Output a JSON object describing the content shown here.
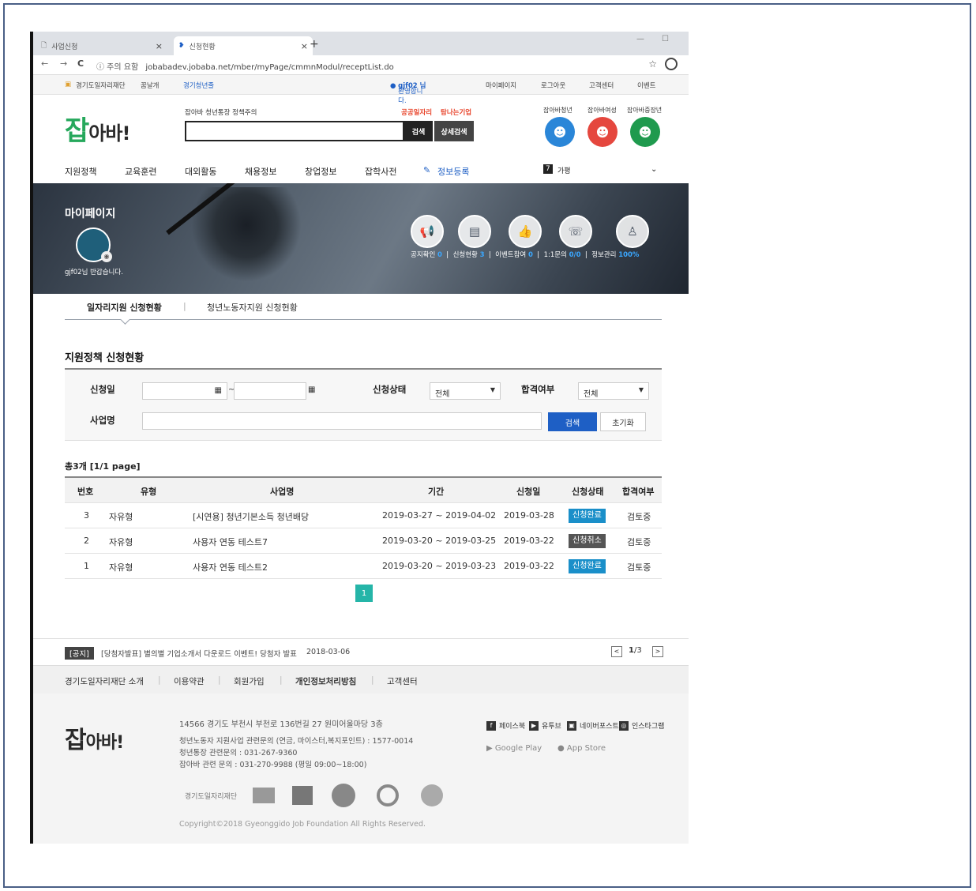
{
  "browser": {
    "tabs": [
      {
        "title": "사업신청"
      },
      {
        "title": "신청현황"
      }
    ],
    "url_warning": "ⓘ 주의 요함",
    "url": "jobabadev.jobaba.net/mber/myPage/cmmnModul/receptList.do"
  },
  "util": {
    "foundation": "경기도일자리재단",
    "dream": "꿈날개",
    "youth": "경기청년줄",
    "welcome_prefix": "환영합니다.",
    "user": "gjf02 님",
    "mypage": "마이페이지",
    "logout": "로그아웃",
    "support": "고객센터",
    "event": "이벤트"
  },
  "header": {
    "logo_main": "잡",
    "logo_sub": "아바!",
    "links": "잡아바   청년통장   정책주의",
    "search_btn": "검색",
    "detail_search_btn": "상세검색",
    "pub_jobs": "공공일자리",
    "good_company": "탐나는기업",
    "avatars": [
      "잡아바청년",
      "잡아바여성",
      "잡아바중장년"
    ]
  },
  "gnb": {
    "items": [
      "지원정책",
      "교육훈련",
      "대외활동",
      "채용정보",
      "창업정보",
      "잡학사전",
      "정보등록"
    ],
    "weather_num": "7",
    "weather_txt": "가평"
  },
  "hero": {
    "title": "마이페이지",
    "greeting": "gjf02님 반갑습니다.",
    "stats": [
      {
        "label": "공지확인",
        "value": "0"
      },
      {
        "label": "신청현황",
        "value": "3"
      },
      {
        "label": "이벤트참여",
        "value": "0"
      },
      {
        "label": "1:1문의",
        "value": "0/0"
      },
      {
        "label": "정보관리",
        "value": "100%"
      }
    ]
  },
  "subtabs": {
    "active": "일자리지원 신청현황",
    "other": "청년노동자지원 신청현황"
  },
  "section_title": "지원정책 신청현황",
  "filter": {
    "date_label": "신청일",
    "tilde": "~",
    "status_label": "신청상태",
    "status_value": "전체",
    "pass_label": "합격여부",
    "pass_value": "전체",
    "name_label": "사업명",
    "search_btn": "검색",
    "reset_btn": "초기화"
  },
  "total": "총3개 [1/1 page]",
  "table": {
    "headers": [
      "번호",
      "유형",
      "사업명",
      "기간",
      "신청일",
      "신청상태",
      "합격여부"
    ],
    "rows": [
      {
        "no": "3",
        "type": "자유형",
        "name": "[시연용] 청년기본소득 청년배당",
        "period": "2019-03-27 ~ 2019-04-02",
        "date": "2019-03-28",
        "status": "신청완료",
        "result": "검토중"
      },
      {
        "no": "2",
        "type": "자유형",
        "name": "사용자 연동 테스트7",
        "period": "2019-03-20 ~ 2019-03-25",
        "date": "2019-03-22",
        "status": "신청취소",
        "result": "검토중"
      },
      {
        "no": "1",
        "type": "자유형",
        "name": "사용자 연동 테스트2",
        "period": "2019-03-20 ~ 2019-03-23",
        "date": "2019-03-22",
        "status": "신청완료",
        "result": "검토중"
      }
    ]
  },
  "pager": {
    "current": "1"
  },
  "notice": {
    "tag": "[공지]",
    "text": "[당첨자발표] 별의별 기업소개서 다운로드 이벤트! 당첨자 발표",
    "date": "2018-03-06",
    "page_current": "1",
    "page_total": "/3"
  },
  "footer_nav": [
    "경기도일자리재단 소개",
    "이용약관",
    "회원가입",
    "개인정보처리방침",
    "고객센터"
  ],
  "footer": {
    "address": "14566 경기도 부천시 부천로 136번길 27 원미어울마당 3층",
    "line1": "청년노동자 지원사업 관련문의 (연금, 마이스터,복지포인트) : 1577-0014",
    "line2": "청년통장 관련문의 : 031-267-9360",
    "line3": "잡아바 관련 문의 : 031-270-9988 (평일 09:00~18:00)",
    "sns": [
      "페이스북",
      "유투브",
      "네이버포스트",
      "인스타그램"
    ],
    "google_play": "Google Play",
    "app_store": "App Store",
    "partner1": "경기도일자리재단",
    "copyright": "Copyright©2018 Gyeonggido Job Foundation All Rights Reserved."
  },
  "colors": {
    "brand_green": "#26a85c",
    "search_blue": "#1e5fc5",
    "status_done": "#1a8fc9",
    "status_cancel": "#555555",
    "pager": "#25b5a8"
  }
}
